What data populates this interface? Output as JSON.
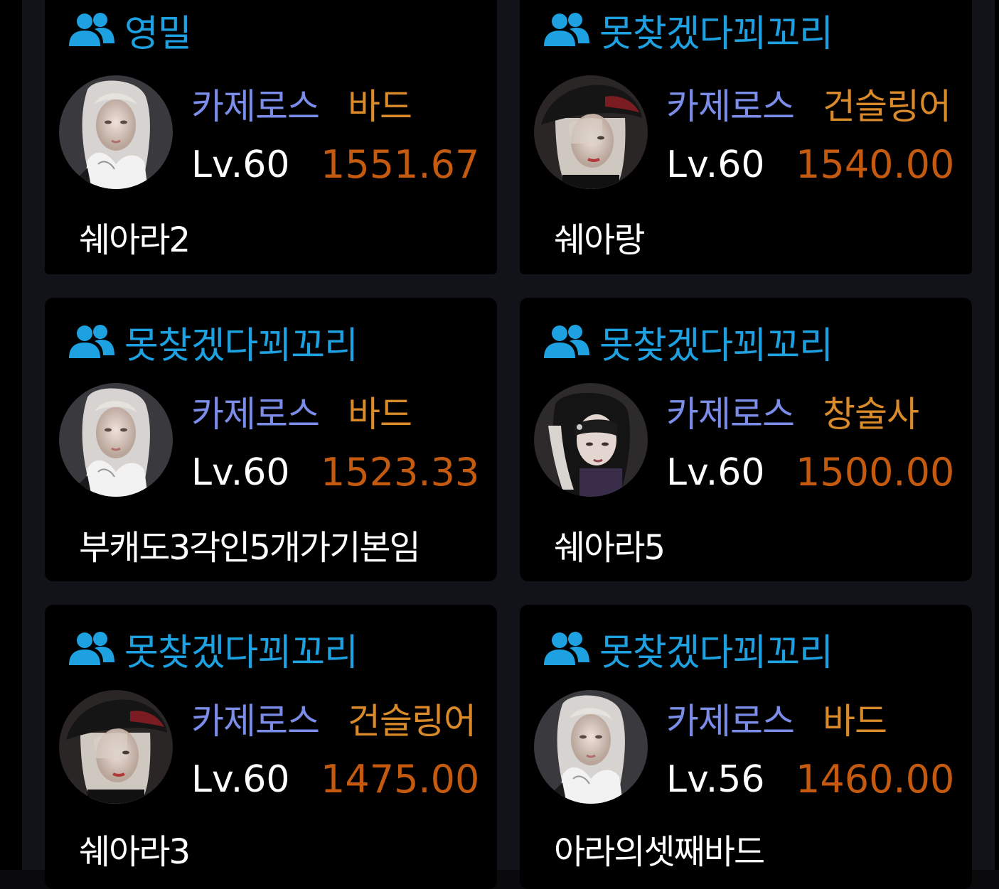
{
  "cards": [
    {
      "guild": "영밀",
      "server": "카제로스",
      "class": "바드",
      "level": "Lv.60",
      "item_level": "1551.67",
      "name": "쉐아라2",
      "portrait": "bard-portrait"
    },
    {
      "guild": "못찾겠다꾀꼬리",
      "server": "카제로스",
      "class": "건슬링어",
      "level": "Lv.60",
      "item_level": "1540.00",
      "name": "쉐아랑",
      "portrait": "gunslinger-portrait"
    },
    {
      "guild": "못찾겠다꾀꼬리",
      "server": "카제로스",
      "class": "바드",
      "level": "Lv.60",
      "item_level": "1523.33",
      "name": "부캐도3각인5개가기본임",
      "portrait": "bard-portrait"
    },
    {
      "guild": "못찾겠다꾀꼬리",
      "server": "카제로스",
      "class": "창술사",
      "level": "Lv.60",
      "item_level": "1500.00",
      "name": "쉐아라5",
      "portrait": "lancemaster-portrait"
    },
    {
      "guild": "못찾겠다꾀꼬리",
      "server": "카제로스",
      "class": "건슬링어",
      "level": "Lv.60",
      "item_level": "1475.00",
      "name": "쉐아라3",
      "portrait": "gunslinger-portrait"
    },
    {
      "guild": "못찾겠다꾀꼬리",
      "server": "카제로스",
      "class": "바드",
      "level": "Lv.56",
      "item_level": "1460.00",
      "name": "아라의셋째바드",
      "portrait": "bard-portrait"
    }
  ],
  "colors": {
    "guild": "#1ea1e0",
    "server": "#7b8de8",
    "class": "#d98a2a",
    "item_level": "#c35a10",
    "card_bg": "#000000",
    "panel_bg": "#121318"
  },
  "icons": {
    "guild": "guild-members-icon"
  }
}
